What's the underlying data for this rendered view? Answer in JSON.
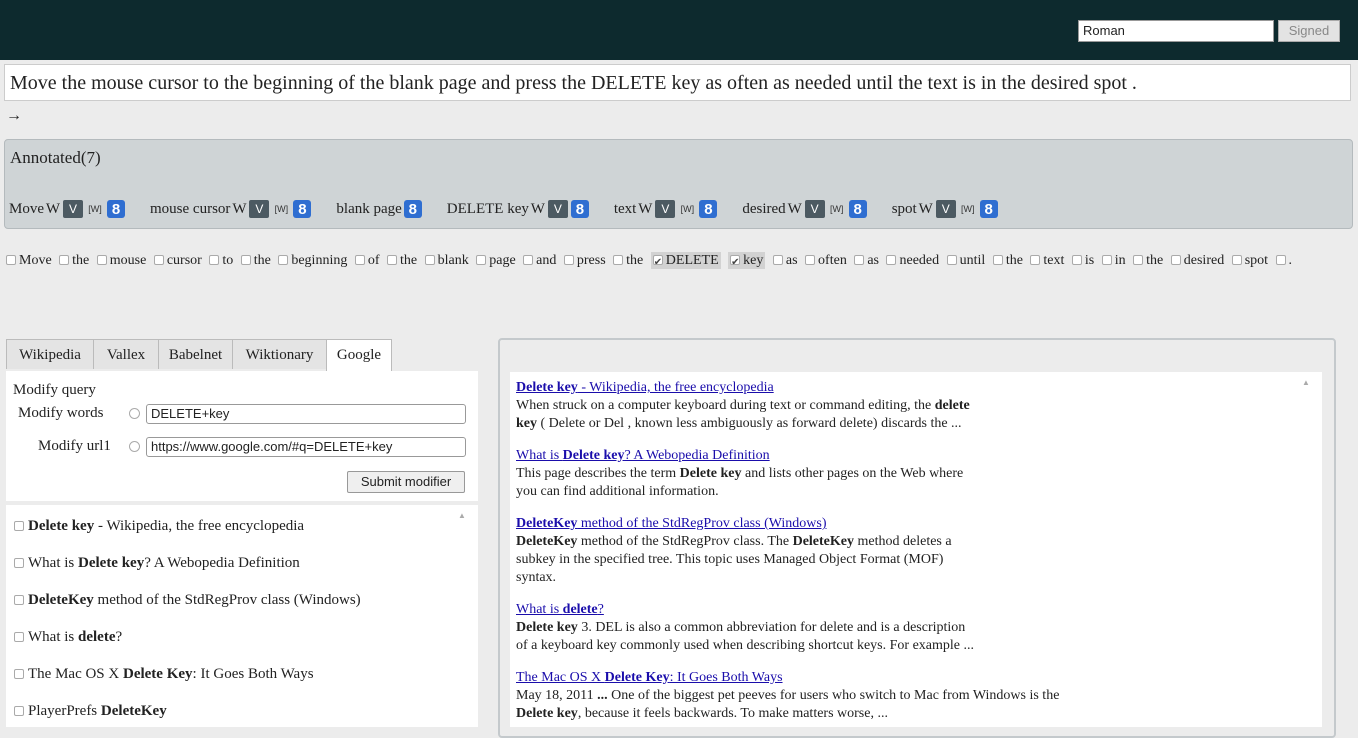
{
  "header": {
    "username": "Roman",
    "signed_label": "Signed"
  },
  "sentence": "Move the mouse cursor to the beginning of the blank page and press the DELETE key as often as needed until the text is in the desired spot .",
  "arrow": "→",
  "annotated": {
    "title": "Annotated(7)",
    "items": [
      {
        "word": "Move",
        "icons": [
          "W",
          "vallex",
          "[W]",
          "8"
        ]
      },
      {
        "word": "mouse cursor",
        "icons": [
          "W",
          "vallex",
          "[W]",
          "8"
        ]
      },
      {
        "word": "blank page",
        "icons": [
          "8"
        ]
      },
      {
        "word": "DELETE key",
        "icons": [
          "W",
          "vallex",
          "8"
        ]
      },
      {
        "word": "text",
        "icons": [
          "W",
          "vallex",
          "[W]",
          "8"
        ]
      },
      {
        "word": "desired",
        "icons": [
          "W",
          "vallex",
          "[W]",
          "8"
        ]
      },
      {
        "word": "spot",
        "icons": [
          "W",
          "vallex",
          "[W]",
          "8"
        ]
      }
    ]
  },
  "words": [
    {
      "t": "Move",
      "c": false
    },
    {
      "t": "the",
      "c": false
    },
    {
      "t": "mouse",
      "c": false
    },
    {
      "t": "cursor",
      "c": false
    },
    {
      "t": "to",
      "c": false
    },
    {
      "t": "the",
      "c": false
    },
    {
      "t": "beginning",
      "c": false
    },
    {
      "t": "of",
      "c": false
    },
    {
      "t": "the",
      "c": false
    },
    {
      "t": "blank",
      "c": false
    },
    {
      "t": "page",
      "c": false
    },
    {
      "t": "and",
      "c": false
    },
    {
      "t": "press",
      "c": false
    },
    {
      "t": "the",
      "c": false
    },
    {
      "t": "DELETE",
      "c": true
    },
    {
      "t": "key",
      "c": true
    },
    {
      "t": "as",
      "c": false
    },
    {
      "t": "often",
      "c": false
    },
    {
      "t": "as",
      "c": false
    },
    {
      "t": "needed",
      "c": false
    },
    {
      "t": "until",
      "c": false
    },
    {
      "t": "the",
      "c": false
    },
    {
      "t": "text",
      "c": false
    },
    {
      "t": "is",
      "c": false
    },
    {
      "t": "in",
      "c": false
    },
    {
      "t": "the",
      "c": false
    },
    {
      "t": "desired",
      "c": false
    },
    {
      "t": "spot",
      "c": false
    },
    {
      "t": ".",
      "c": false
    }
  ],
  "tabs": [
    "Wikipedia",
    "Vallex",
    "Babelnet",
    "Wiktionary",
    "Google"
  ],
  "active_tab": "Google",
  "query": {
    "title": "Modify query",
    "words_label": "Modify words",
    "words_value": "DELETE+key",
    "url_label": "Modify url1",
    "url_value": "https://www.google.com/#q=DELETE+key",
    "submit_label": "Submit modifier"
  },
  "result_list": [
    {
      "parts": [
        {
          "b": true,
          "t": "Delete key"
        },
        {
          "b": false,
          "t": " - Wikipedia, the free encyclopedia"
        }
      ]
    },
    {
      "parts": [
        {
          "b": false,
          "t": "What is "
        },
        {
          "b": true,
          "t": "Delete key"
        },
        {
          "b": false,
          "t": "? A Webopedia Definition"
        }
      ]
    },
    {
      "parts": [
        {
          "b": true,
          "t": "DeleteKey"
        },
        {
          "b": false,
          "t": " method of the StdRegProv class (Windows)"
        }
      ]
    },
    {
      "parts": [
        {
          "b": false,
          "t": "What is "
        },
        {
          "b": true,
          "t": "delete"
        },
        {
          "b": false,
          "t": "?"
        }
      ]
    },
    {
      "parts": [
        {
          "b": false,
          "t": "The Mac OS X "
        },
        {
          "b": true,
          "t": "Delete Key"
        },
        {
          "b": false,
          "t": ": It Goes Both Ways"
        }
      ]
    },
    {
      "parts": [
        {
          "b": false,
          "t": "PlayerPrefs "
        },
        {
          "b": true,
          "t": "DeleteKey"
        }
      ]
    }
  ],
  "results": [
    {
      "title": [
        {
          "b": true,
          "t": "Delete key"
        },
        {
          "b": false,
          "t": " - Wikipedia, the free encyclopedia"
        }
      ],
      "lines": [
        [
          {
            "b": false,
            "t": "When struck on a computer keyboard during text or command editing, the "
          },
          {
            "b": true,
            "t": "delete"
          }
        ],
        [
          {
            "b": true,
            "t": "key"
          },
          {
            "b": false,
            "t": " ( Delete or Del , known less ambiguously as forward delete) discards the ..."
          }
        ]
      ]
    },
    {
      "title": [
        {
          "b": false,
          "t": "What is "
        },
        {
          "b": true,
          "t": "Delete key"
        },
        {
          "b": false,
          "t": "? A Webopedia Definition"
        }
      ],
      "lines": [
        [
          {
            "b": false,
            "t": "This page describes the term "
          },
          {
            "b": true,
            "t": "Delete key"
          },
          {
            "b": false,
            "t": " and lists other pages on the Web where"
          }
        ],
        [
          {
            "b": false,
            "t": "you can find additional information."
          }
        ]
      ]
    },
    {
      "title": [
        {
          "b": true,
          "t": "DeleteKey"
        },
        {
          "b": false,
          "t": " method of the StdRegProv class (Windows)"
        }
      ],
      "lines": [
        [
          {
            "b": true,
            "t": "DeleteKey"
          },
          {
            "b": false,
            "t": " method of the StdRegProv class. The "
          },
          {
            "b": true,
            "t": "DeleteKey"
          },
          {
            "b": false,
            "t": " method deletes a"
          }
        ],
        [
          {
            "b": false,
            "t": "subkey in the specified tree. This topic uses Managed Object Format (MOF)"
          }
        ],
        [
          {
            "b": false,
            "t": "syntax."
          }
        ]
      ]
    },
    {
      "title": [
        {
          "b": false,
          "t": "What is "
        },
        {
          "b": true,
          "t": "delete"
        },
        {
          "b": false,
          "t": "?"
        }
      ],
      "lines": [
        [
          {
            "b": true,
            "t": "Delete key"
          },
          {
            "b": false,
            "t": " 3. DEL is also a common abbreviation for delete and is a description"
          }
        ],
        [
          {
            "b": false,
            "t": "of a keyboard key commonly used when describing shortcut keys. For example ..."
          }
        ]
      ]
    },
    {
      "title": [
        {
          "b": false,
          "t": "The Mac OS X "
        },
        {
          "b": true,
          "t": "Delete Key"
        },
        {
          "b": false,
          "t": ": It Goes Both Ways"
        }
      ],
      "lines": [
        [
          {
            "b": false,
            "t": "May 18, 2011 "
          },
          {
            "b": true,
            "t": "..."
          },
          {
            "b": false,
            "t": " One of the biggest pet peeves for users who switch to Mac from Windows is the"
          }
        ],
        [
          {
            "b": true,
            "t": "Delete key"
          },
          {
            "b": false,
            "t": ", because it feels backwards. To make matters worse, ..."
          }
        ]
      ]
    }
  ]
}
